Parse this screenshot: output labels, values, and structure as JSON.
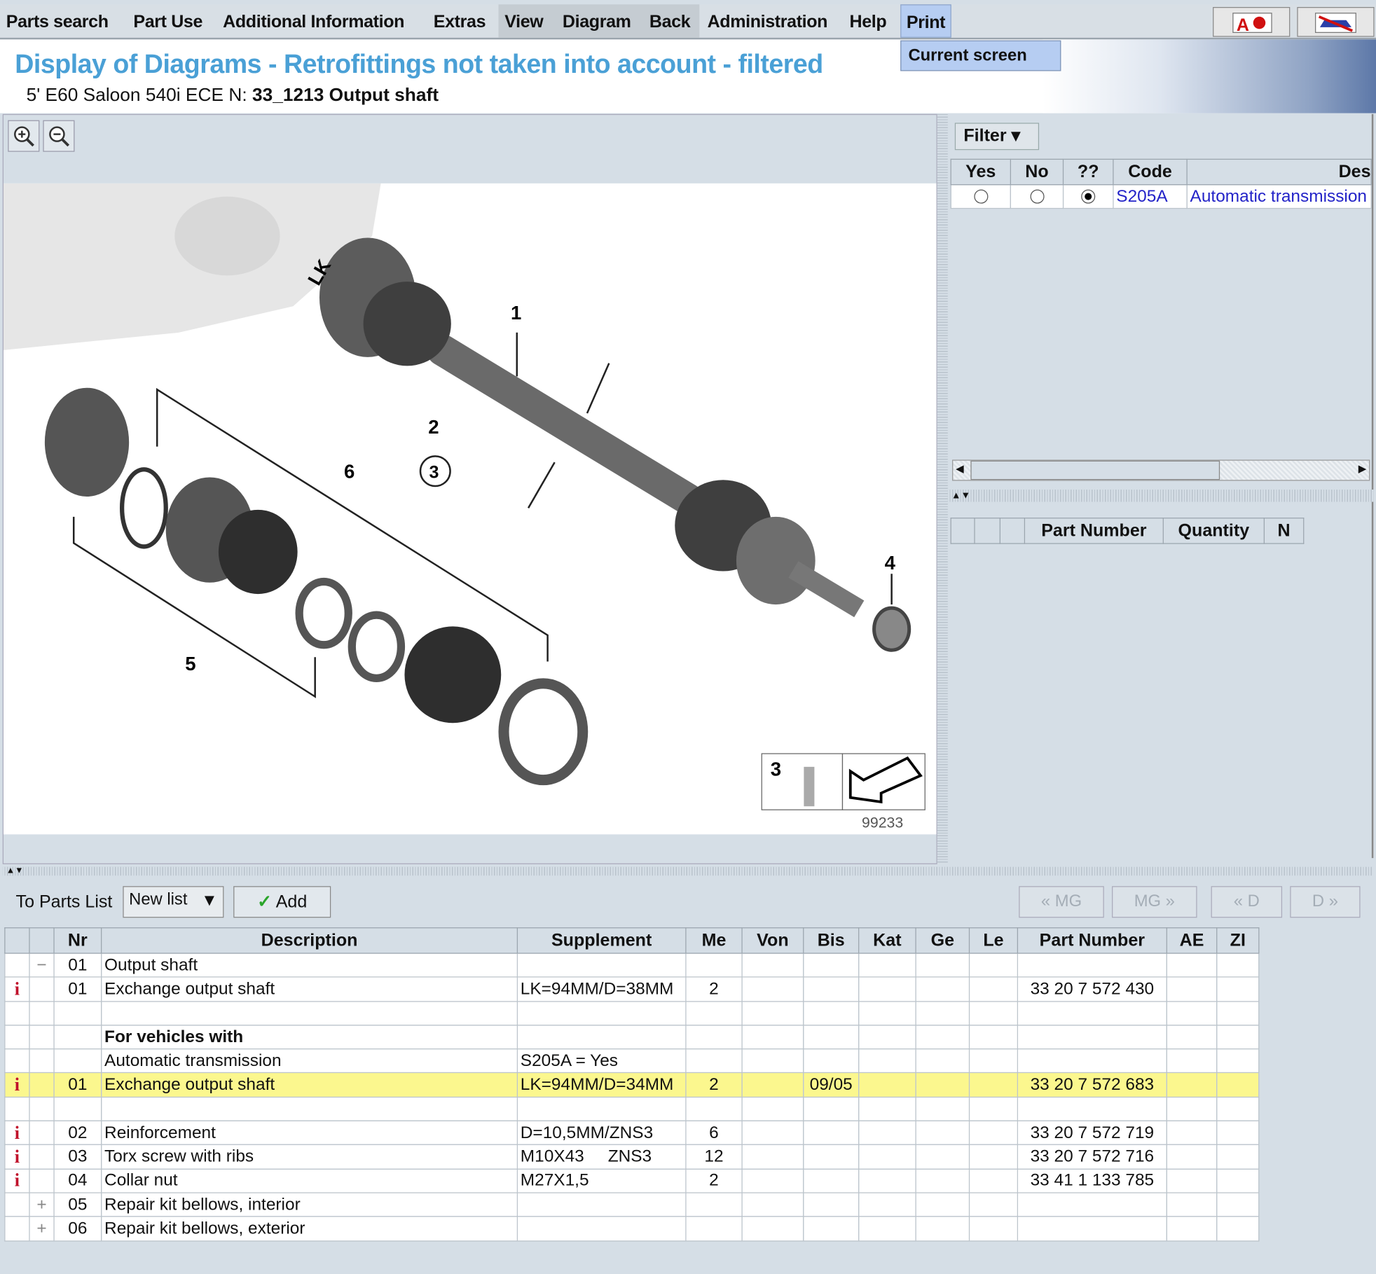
{
  "menu": {
    "items": [
      "Parts search",
      "Part Use",
      "Additional Information",
      "Extras",
      "View",
      "Diagram",
      "Back",
      "Administration",
      "Help",
      "Print"
    ],
    "dropdown_item": "Current screen"
  },
  "header": {
    "title": "Display of Diagrams - Retrofittings not taken into account - filtered",
    "vehicle": "5' E60 Saloon 540i ECE",
    "n_label": "N:",
    "group": "33_1213 Output shaft"
  },
  "diagram": {
    "callouts": [
      "1",
      "2",
      "3",
      "4",
      "5",
      "6",
      "LK"
    ],
    "legend_number": "3",
    "image_number": "99233"
  },
  "filter": {
    "button": "Filter",
    "columns": [
      "Yes",
      "No",
      "??",
      "Code",
      "Des"
    ],
    "rows": [
      {
        "yes": false,
        "no": false,
        "unknown": true,
        "code": "S205A",
        "description": "Automatic transmission"
      }
    ]
  },
  "partlist_panel": {
    "columns": [
      "",
      "",
      "",
      "Part Number",
      "Quantity",
      "N"
    ]
  },
  "toolbar": {
    "to_parts_list": "To Parts List",
    "list_select": "New list",
    "add": "Add",
    "nav": [
      "« MG",
      "MG »",
      "« D",
      "D »"
    ]
  },
  "parts": {
    "columns": [
      "",
      "",
      "Nr",
      "Description",
      "Supplement",
      "Me",
      "Von",
      "Bis",
      "Kat",
      "Ge",
      "Le",
      "Part Number",
      "AE",
      "ZI"
    ],
    "rows": [
      {
        "info": false,
        "tree": "−",
        "nr": "01",
        "desc": "Output shaft",
        "supp": "",
        "me": "",
        "bis": "",
        "pn": "",
        "bold": false,
        "hl": false
      },
      {
        "info": true,
        "tree": "",
        "nr": "01",
        "desc": "Exchange output shaft",
        "supp": "LK=94MM/D=38MM",
        "me": "2",
        "bis": "",
        "pn": "33 20 7 572 430",
        "bold": false,
        "hl": false
      },
      {
        "info": false,
        "tree": "",
        "nr": "",
        "desc": "",
        "supp": "",
        "me": "",
        "bis": "",
        "pn": "",
        "bold": false,
        "hl": false
      },
      {
        "info": false,
        "tree": "",
        "nr": "",
        "desc": "For vehicles with",
        "supp": "",
        "me": "",
        "bis": "",
        "pn": "",
        "bold": true,
        "hl": false
      },
      {
        "info": false,
        "tree": "",
        "nr": "",
        "desc": "Automatic transmission",
        "supp": "S205A = Yes",
        "me": "",
        "bis": "",
        "pn": "",
        "bold": false,
        "hl": false
      },
      {
        "info": true,
        "tree": "",
        "nr": "01",
        "desc": "Exchange output shaft",
        "supp": "LK=94MM/D=34MM",
        "me": "2",
        "bis": "09/05",
        "pn": "33 20 7 572 683",
        "bold": false,
        "hl": true
      },
      {
        "info": false,
        "tree": "",
        "nr": "",
        "desc": "",
        "supp": "",
        "me": "",
        "bis": "",
        "pn": "",
        "bold": false,
        "hl": false
      },
      {
        "info": true,
        "tree": "",
        "nr": "02",
        "desc": "Reinforcement",
        "supp": "D=10,5MM/ZNS3",
        "me": "6",
        "bis": "",
        "pn": "33 20 7 572 719",
        "bold": false,
        "hl": false
      },
      {
        "info": true,
        "tree": "",
        "nr": "03",
        "desc": "Torx screw with ribs",
        "supp": "M10X43     ZNS3",
        "me": "12",
        "bis": "",
        "pn": "33 20 7 572 716",
        "bold": false,
        "hl": false
      },
      {
        "info": true,
        "tree": "",
        "nr": "04",
        "desc": "Collar nut",
        "supp": "M27X1,5",
        "me": "2",
        "bis": "",
        "pn": "33 41 1 133 785",
        "bold": false,
        "hl": false
      },
      {
        "info": false,
        "tree": "+",
        "nr": "05",
        "desc": "Repair kit bellows, interior",
        "supp": "",
        "me": "",
        "bis": "",
        "pn": "",
        "bold": false,
        "hl": false
      },
      {
        "info": false,
        "tree": "+",
        "nr": "06",
        "desc": "Repair kit bellows, exterior",
        "supp": "",
        "me": "",
        "bis": "",
        "pn": "",
        "bold": false,
        "hl": false
      }
    ]
  },
  "colors": {
    "title": "#4aa0d6",
    "highlight_row": "#fbf78e",
    "info_icon": "#c0102a",
    "link": "#2323c8",
    "print_menu": "#b6cdf2"
  }
}
